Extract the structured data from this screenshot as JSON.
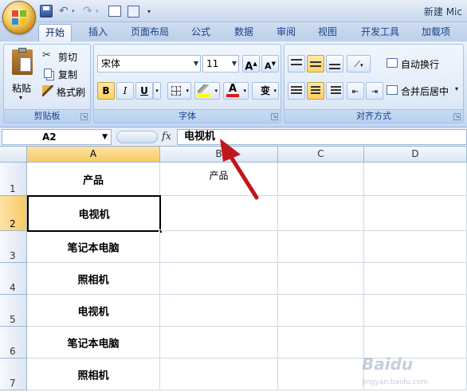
{
  "window": {
    "title": "新建 Mic"
  },
  "ribbon": {
    "tabs": [
      "开始",
      "插入",
      "页面布局",
      "公式",
      "数据",
      "审阅",
      "视图",
      "开发工具",
      "加载项"
    ],
    "clipboard": {
      "label": "剪贴板",
      "paste": "粘贴",
      "cut": "剪切",
      "copy": "复制",
      "format_painter": "格式刷"
    },
    "font": {
      "label": "字体",
      "name": "宋体",
      "size": "11",
      "bold": "B",
      "italic": "I",
      "underline": "U",
      "grow": "A",
      "shrink": "A",
      "color_glyph": "A",
      "wen": "变"
    },
    "alignment": {
      "label": "对齐方式",
      "wrap_text": "自动换行",
      "merge_center": "合并后居中"
    }
  },
  "formula_bar": {
    "name_box": "A2",
    "fx": "fx",
    "content": "电视机"
  },
  "grid": {
    "columns": [
      "A",
      "B",
      "C",
      "D"
    ],
    "selected_column": "A",
    "selected_row": "2",
    "rows": [
      {
        "num": "1",
        "a": "产品",
        "b": "产品"
      },
      {
        "num": "2",
        "a": "电视机",
        "b": ""
      },
      {
        "num": "3",
        "a": "笔记本电脑",
        "b": ""
      },
      {
        "num": "4",
        "a": "照相机",
        "b": ""
      },
      {
        "num": "5",
        "a": "电视机",
        "b": ""
      },
      {
        "num": "6",
        "a": "笔记本电脑",
        "b": ""
      },
      {
        "num": "7",
        "a": "照相机",
        "b": ""
      }
    ]
  },
  "annotation": {
    "arrow_color": "#c0161c"
  },
  "colors": {
    "ribbon_text": "#15428b",
    "selected_header": "#f8c967",
    "arrow": "#c0161c"
  }
}
